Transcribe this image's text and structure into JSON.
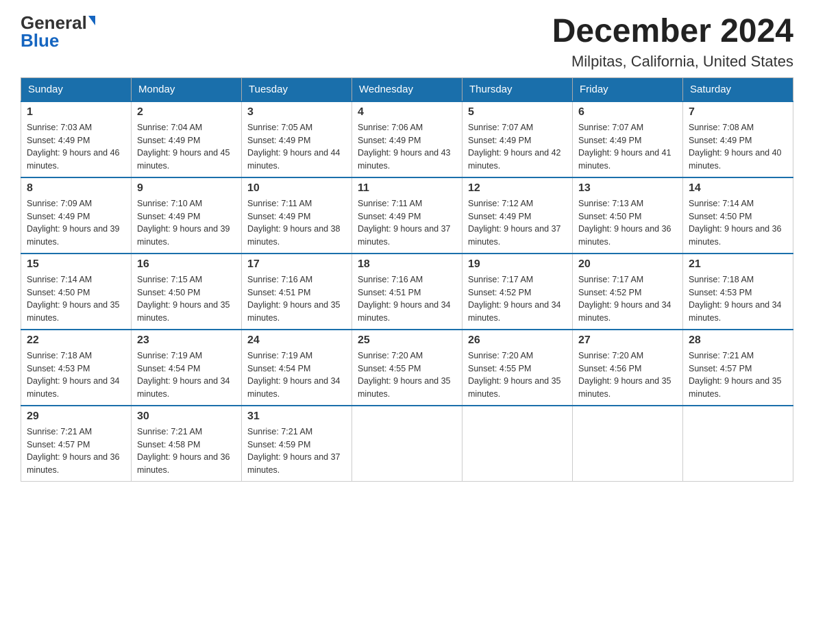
{
  "logo": {
    "general": "General",
    "blue": "Blue"
  },
  "title": "December 2024",
  "subtitle": "Milpitas, California, United States",
  "days_of_week": [
    "Sunday",
    "Monday",
    "Tuesday",
    "Wednesday",
    "Thursday",
    "Friday",
    "Saturday"
  ],
  "weeks": [
    [
      {
        "num": "1",
        "sunrise": "7:03 AM",
        "sunset": "4:49 PM",
        "daylight": "9 hours and 46 minutes."
      },
      {
        "num": "2",
        "sunrise": "7:04 AM",
        "sunset": "4:49 PM",
        "daylight": "9 hours and 45 minutes."
      },
      {
        "num": "3",
        "sunrise": "7:05 AM",
        "sunset": "4:49 PM",
        "daylight": "9 hours and 44 minutes."
      },
      {
        "num": "4",
        "sunrise": "7:06 AM",
        "sunset": "4:49 PM",
        "daylight": "9 hours and 43 minutes."
      },
      {
        "num": "5",
        "sunrise": "7:07 AM",
        "sunset": "4:49 PM",
        "daylight": "9 hours and 42 minutes."
      },
      {
        "num": "6",
        "sunrise": "7:07 AM",
        "sunset": "4:49 PM",
        "daylight": "9 hours and 41 minutes."
      },
      {
        "num": "7",
        "sunrise": "7:08 AM",
        "sunset": "4:49 PM",
        "daylight": "9 hours and 40 minutes."
      }
    ],
    [
      {
        "num": "8",
        "sunrise": "7:09 AM",
        "sunset": "4:49 PM",
        "daylight": "9 hours and 39 minutes."
      },
      {
        "num": "9",
        "sunrise": "7:10 AM",
        "sunset": "4:49 PM",
        "daylight": "9 hours and 39 minutes."
      },
      {
        "num": "10",
        "sunrise": "7:11 AM",
        "sunset": "4:49 PM",
        "daylight": "9 hours and 38 minutes."
      },
      {
        "num": "11",
        "sunrise": "7:11 AM",
        "sunset": "4:49 PM",
        "daylight": "9 hours and 37 minutes."
      },
      {
        "num": "12",
        "sunrise": "7:12 AM",
        "sunset": "4:49 PM",
        "daylight": "9 hours and 37 minutes."
      },
      {
        "num": "13",
        "sunrise": "7:13 AM",
        "sunset": "4:50 PM",
        "daylight": "9 hours and 36 minutes."
      },
      {
        "num": "14",
        "sunrise": "7:14 AM",
        "sunset": "4:50 PM",
        "daylight": "9 hours and 36 minutes."
      }
    ],
    [
      {
        "num": "15",
        "sunrise": "7:14 AM",
        "sunset": "4:50 PM",
        "daylight": "9 hours and 35 minutes."
      },
      {
        "num": "16",
        "sunrise": "7:15 AM",
        "sunset": "4:50 PM",
        "daylight": "9 hours and 35 minutes."
      },
      {
        "num": "17",
        "sunrise": "7:16 AM",
        "sunset": "4:51 PM",
        "daylight": "9 hours and 35 minutes."
      },
      {
        "num": "18",
        "sunrise": "7:16 AM",
        "sunset": "4:51 PM",
        "daylight": "9 hours and 34 minutes."
      },
      {
        "num": "19",
        "sunrise": "7:17 AM",
        "sunset": "4:52 PM",
        "daylight": "9 hours and 34 minutes."
      },
      {
        "num": "20",
        "sunrise": "7:17 AM",
        "sunset": "4:52 PM",
        "daylight": "9 hours and 34 minutes."
      },
      {
        "num": "21",
        "sunrise": "7:18 AM",
        "sunset": "4:53 PM",
        "daylight": "9 hours and 34 minutes."
      }
    ],
    [
      {
        "num": "22",
        "sunrise": "7:18 AM",
        "sunset": "4:53 PM",
        "daylight": "9 hours and 34 minutes."
      },
      {
        "num": "23",
        "sunrise": "7:19 AM",
        "sunset": "4:54 PM",
        "daylight": "9 hours and 34 minutes."
      },
      {
        "num": "24",
        "sunrise": "7:19 AM",
        "sunset": "4:54 PM",
        "daylight": "9 hours and 34 minutes."
      },
      {
        "num": "25",
        "sunrise": "7:20 AM",
        "sunset": "4:55 PM",
        "daylight": "9 hours and 35 minutes."
      },
      {
        "num": "26",
        "sunrise": "7:20 AM",
        "sunset": "4:55 PM",
        "daylight": "9 hours and 35 minutes."
      },
      {
        "num": "27",
        "sunrise": "7:20 AM",
        "sunset": "4:56 PM",
        "daylight": "9 hours and 35 minutes."
      },
      {
        "num": "28",
        "sunrise": "7:21 AM",
        "sunset": "4:57 PM",
        "daylight": "9 hours and 35 minutes."
      }
    ],
    [
      {
        "num": "29",
        "sunrise": "7:21 AM",
        "sunset": "4:57 PM",
        "daylight": "9 hours and 36 minutes."
      },
      {
        "num": "30",
        "sunrise": "7:21 AM",
        "sunset": "4:58 PM",
        "daylight": "9 hours and 36 minutes."
      },
      {
        "num": "31",
        "sunrise": "7:21 AM",
        "sunset": "4:59 PM",
        "daylight": "9 hours and 37 minutes."
      },
      null,
      null,
      null,
      null
    ]
  ]
}
